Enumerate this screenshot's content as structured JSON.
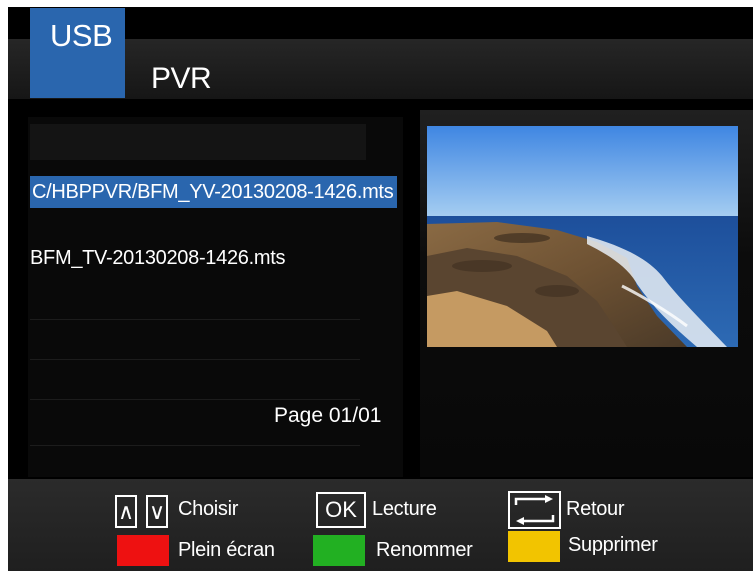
{
  "header": {
    "tab_label": "USB",
    "title": "PVR"
  },
  "file_list": {
    "items": [
      {
        "label": "C/HBPPVR/BFM_YV-20130208-1426.mts",
        "selected": true
      },
      {
        "label": "BFM_TV-20130208-1426.mts",
        "selected": false
      }
    ],
    "page_indicator": "Page 01/01"
  },
  "preview": {
    "description_icon": "beach-thumbnail"
  },
  "footer": {
    "up_key": "∧",
    "down_key": "∨",
    "choose_label": "Choisir",
    "ok_key": "OK",
    "play_label": "Lecture",
    "back_label": "Retour",
    "fullscreen_label": "Plein écran",
    "rename_label": "Renommer",
    "delete_label": "Supprimer",
    "colors": {
      "red": "#ee1111",
      "green": "#22b022",
      "yellow": "#f2c400"
    }
  },
  "colors": {
    "accent": "#2a66ae"
  }
}
